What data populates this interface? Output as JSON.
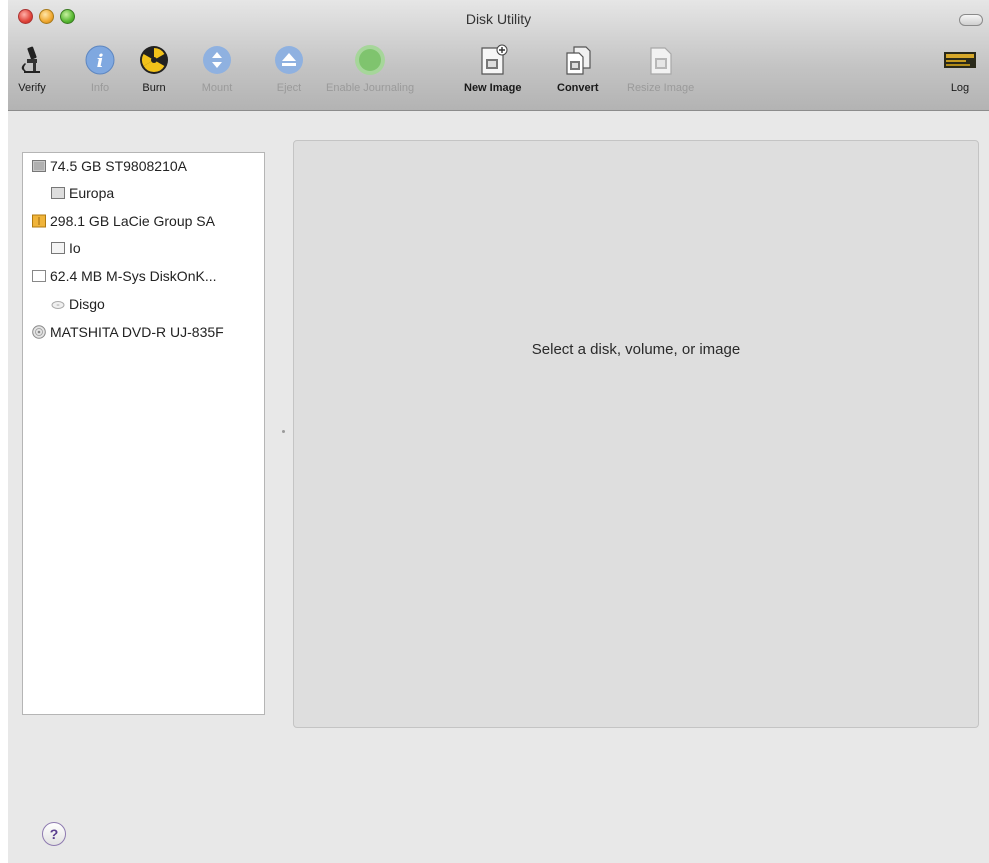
{
  "window": {
    "title": "Disk Utility"
  },
  "toolbar": {
    "verify": "Verify",
    "info": "Info",
    "burn": "Burn",
    "mount": "Mount",
    "eject": "Eject",
    "enable_journaling": "Enable Journaling",
    "new_image": "New Image",
    "convert": "Convert",
    "resize_image": "Resize Image",
    "log": "Log"
  },
  "sidebar": {
    "items": [
      {
        "label": "74.5 GB ST9808210A",
        "icon": "internal-disk-icon"
      },
      {
        "label": "Europa",
        "icon": "volume-icon"
      },
      {
        "label": "298.1 GB LaCie Group SA",
        "icon": "external-disk-icon"
      },
      {
        "label": "Io",
        "icon": "volume-icon"
      },
      {
        "label": "62.4 MB M-Sys DiskOnK...",
        "icon": "usb-disk-icon"
      },
      {
        "label": "Disgo",
        "icon": "volume-icon"
      },
      {
        "label": "MATSHITA DVD-R UJ-835F",
        "icon": "optical-drive-icon"
      }
    ]
  },
  "main": {
    "placeholder": "Select a disk, volume, or image"
  },
  "help": {
    "label": "?"
  },
  "colors": {
    "info_blue": "#3a7bd5",
    "burn_yellow": "#f2c21a",
    "journaling_green": "#5fbf4a"
  }
}
